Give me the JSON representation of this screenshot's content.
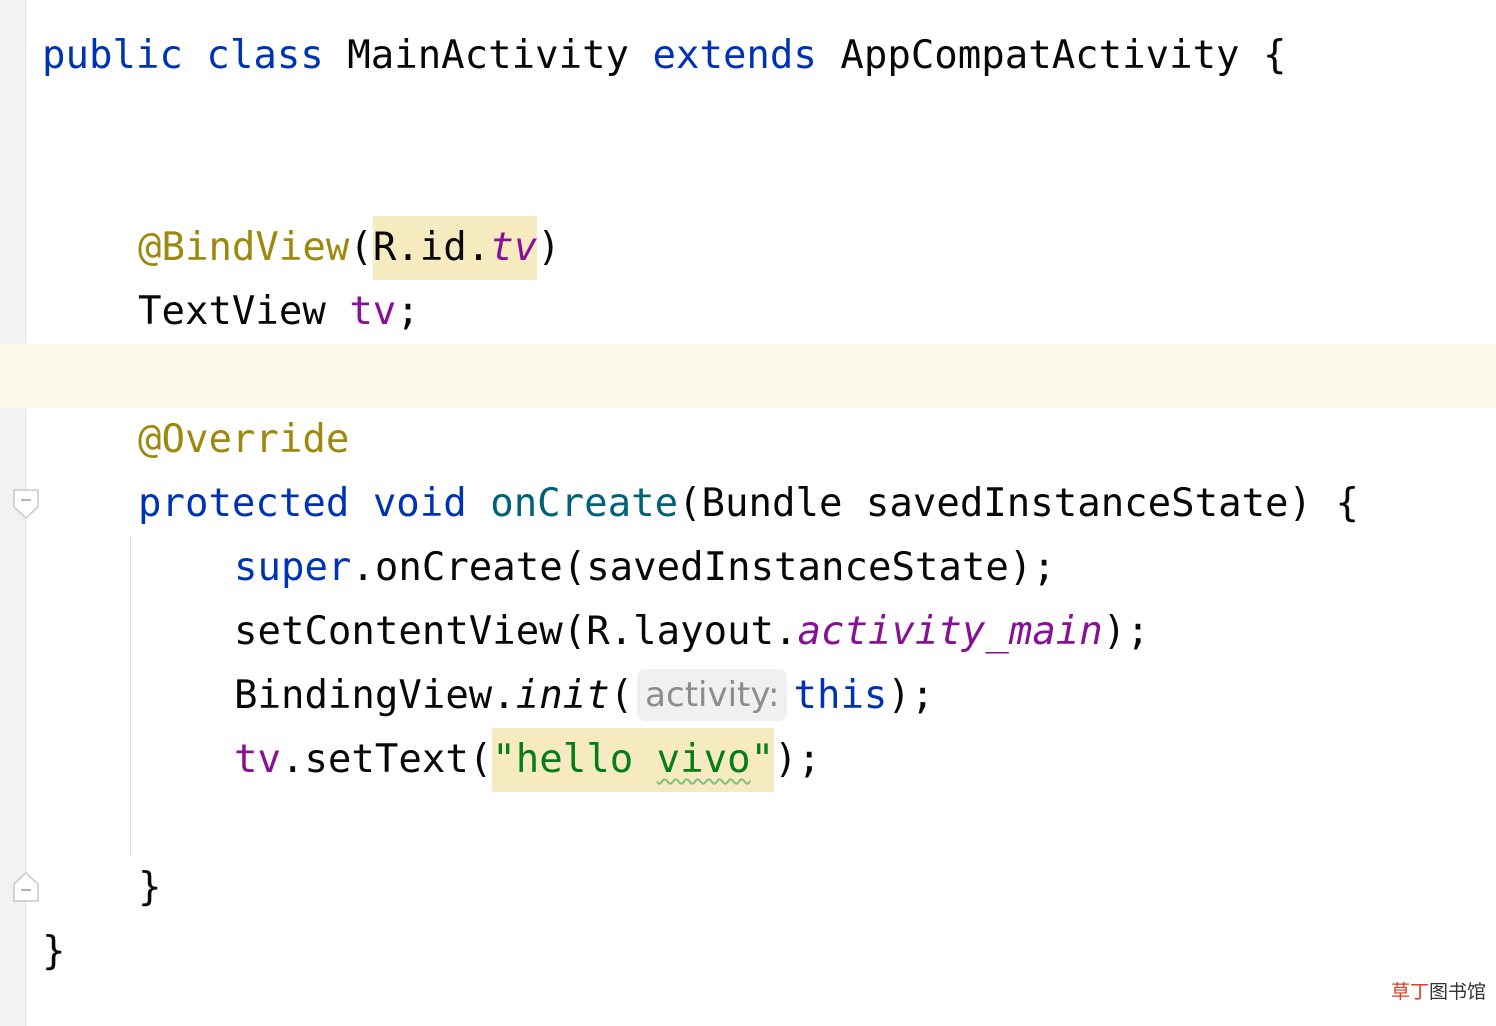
{
  "editor": {
    "line1": {
      "kw_public": "public",
      "kw_class": "class",
      "class_name": "MainActivity",
      "kw_extends": "extends",
      "parent": "AppCompatActivity",
      "brace": "{"
    },
    "line2": {
      "annotation": "@BindView",
      "open": "(",
      "ref": "R.id.",
      "field": "tv",
      "close": ")"
    },
    "line3": {
      "type": "TextView",
      "field": "tv",
      "semi": ";"
    },
    "line4": {
      "annotation": "@Override"
    },
    "line5": {
      "kw_protected": "protected",
      "kw_void": "void",
      "method": "onCreate",
      "params": "(Bundle savedInstanceState)",
      "brace": "{"
    },
    "line6": {
      "kw_super": "super",
      "rest": ".onCreate(savedInstanceState);"
    },
    "line7": {
      "call": "setContentView(R.layout.",
      "field": "activity_main",
      "end": ");"
    },
    "line8": {
      "call": "BindingView.",
      "method": "init",
      "open": "(",
      "hint": "activity:",
      "kw_this": "this",
      "end": ");"
    },
    "line9": {
      "field": "tv",
      "call": ".setText(",
      "str_open": "\"hello ",
      "str_word": "vivo",
      "str_close": "\"",
      "end": ");"
    },
    "line10": {
      "brace": "}"
    },
    "line11": {
      "brace": "}"
    }
  },
  "watermark": {
    "part1": "草丁",
    "part2": "图书馆"
  }
}
